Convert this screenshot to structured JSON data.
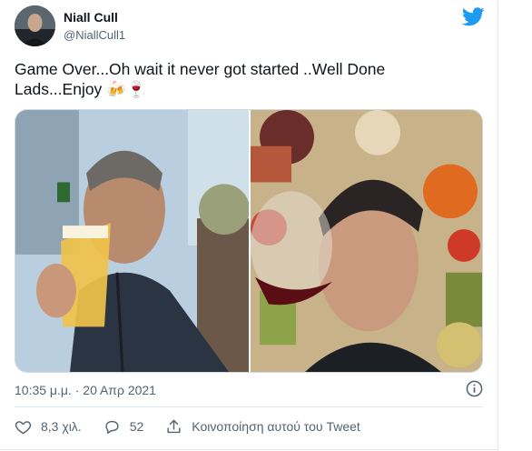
{
  "author": {
    "name": "Niall Cull",
    "handle": "@NiallCull1"
  },
  "tweet": {
    "text": "Game Over...Oh wait it never got started ..Well Done Lads...Enjoy 🍻🍷"
  },
  "timestamp": "10:35 μ.μ. · 20 Απρ 2021",
  "actions": {
    "likes": "8,3 χιλ.",
    "replies": "52",
    "share_label": "Κοινοποίηση αυτού του Tweet"
  },
  "colors": {
    "twitter_blue": "#1d9bf0",
    "text_primary": "#0f1419",
    "text_secondary": "#536471"
  },
  "icons": [
    "twitter-bird-icon",
    "info-icon",
    "heart-icon",
    "reply-icon",
    "share-icon"
  ]
}
